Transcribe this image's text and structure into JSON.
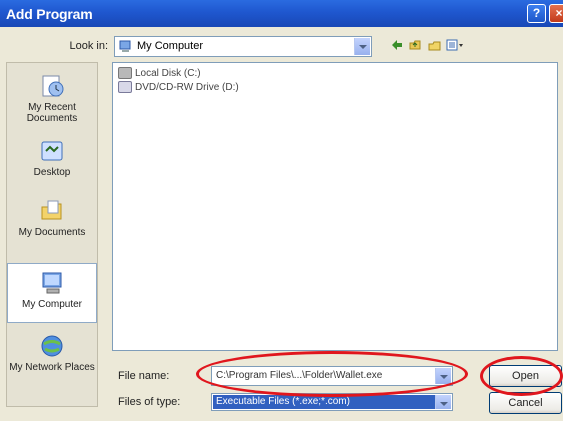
{
  "window": {
    "title": "Add Program",
    "help_label": "?",
    "close_label": "×"
  },
  "lookin": {
    "label": "Look in:",
    "value": "My Computer"
  },
  "toolbar": {
    "back_icon": "back-arrow-icon",
    "up_icon": "up-folder-icon",
    "new_folder_icon": "new-folder-icon",
    "views_icon": "views-menu-icon"
  },
  "places": [
    {
      "label": "My Recent Documents",
      "icon": "recent-documents-icon"
    },
    {
      "label": "Desktop",
      "icon": "desktop-icon"
    },
    {
      "label": "My Documents",
      "icon": "my-documents-icon"
    },
    {
      "label": "My Computer",
      "icon": "my-computer-icon"
    },
    {
      "label": "My Network Places",
      "icon": "network-places-icon"
    }
  ],
  "files": [
    {
      "name": "Local Disk (C:)",
      "icon": "hard-drive-icon"
    },
    {
      "name": "DVD/CD-RW Drive (D:)",
      "icon": "cd-drive-icon"
    }
  ],
  "filename": {
    "label": "File name:",
    "value": "C:\\Program Files\\...\\Folder\\Wallet.exe"
  },
  "filetype": {
    "label": "Files of type:",
    "value": "Executable Files (*.exe;*.com)"
  },
  "buttons": {
    "open": "Open",
    "cancel": "Cancel"
  },
  "colors": {
    "title_bar": "#1f57cf",
    "annotation": "#e0161d",
    "selection": "#3160c0"
  }
}
